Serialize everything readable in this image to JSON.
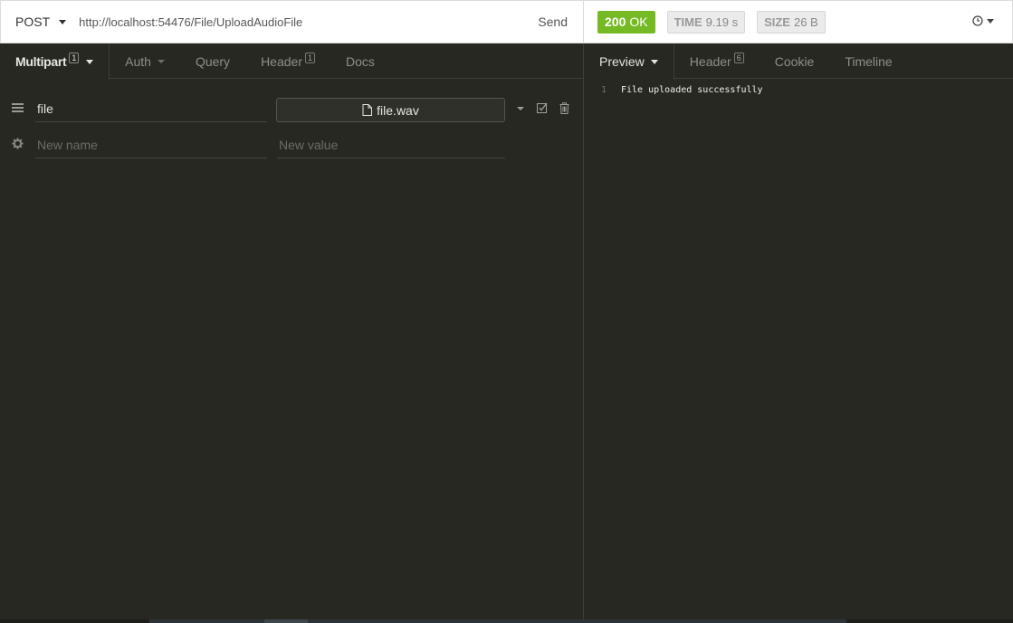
{
  "request": {
    "method": "POST",
    "url": "http://localhost:54476/File/UploadAudioFile",
    "send_label": "Send",
    "tabs": [
      {
        "label": "Multipart",
        "badge": "1"
      },
      {
        "label": "Auth"
      },
      {
        "label": "Query"
      },
      {
        "label": "Header",
        "badge": "1"
      },
      {
        "label": "Docs"
      }
    ],
    "params": [
      {
        "name": "file",
        "file_label": "file.wav"
      }
    ],
    "new_row": {
      "name_placeholder": "New name",
      "value_placeholder": "New value"
    }
  },
  "response": {
    "status_code": "200",
    "status_text": "OK",
    "time_label": "TIME",
    "time_value": "9.19 s",
    "size_label": "SIZE",
    "size_value": "26 B",
    "tabs": [
      {
        "label": "Preview"
      },
      {
        "label": "Header",
        "badge": "6"
      },
      {
        "label": "Cookie"
      },
      {
        "label": "Timeline"
      }
    ],
    "body_lines": [
      {
        "no": "1",
        "text": "File uploaded successfully"
      }
    ]
  },
  "colors": {
    "status_ok": "#75ba24",
    "background": "#272822"
  },
  "icons": [
    "chevron-down-icon",
    "drag-handle-icon",
    "gear-icon",
    "file-icon",
    "checkbox-icon",
    "trash-icon",
    "clock-icon"
  ]
}
